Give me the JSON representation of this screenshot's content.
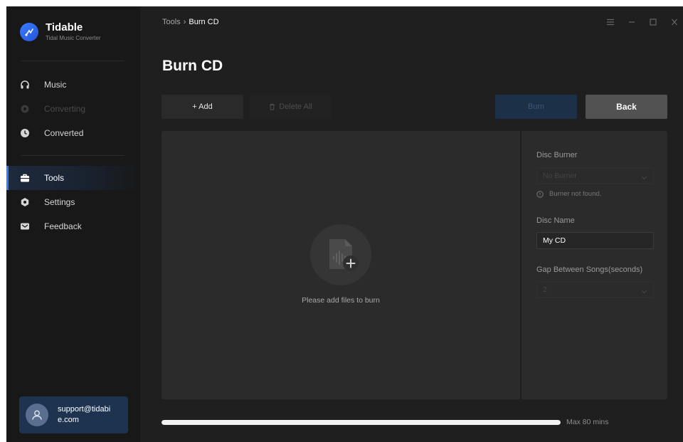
{
  "app": {
    "name": "Tidable",
    "subtitle": "Tidal Music Converter",
    "accent": "#2f7bff"
  },
  "sidebar": {
    "items": [
      {
        "label": "Music",
        "icon": "headphones-icon",
        "state": "normal"
      },
      {
        "label": "Converting",
        "icon": "converting-icon",
        "state": "disabled"
      },
      {
        "label": "Converted",
        "icon": "clock-icon",
        "state": "normal"
      },
      {
        "label": "Tools",
        "icon": "toolbox-icon",
        "state": "active"
      },
      {
        "label": "Settings",
        "icon": "gear-icon",
        "state": "normal"
      },
      {
        "label": "Feedback",
        "icon": "mail-icon",
        "state": "normal"
      }
    ]
  },
  "account": {
    "email": "support@tidabie.com"
  },
  "breadcrumb": {
    "parent": "Tools",
    "separator": "›",
    "current": "Burn CD"
  },
  "page": {
    "title": "Burn CD"
  },
  "toolbar": {
    "add_label": "+ Add",
    "delete_all_label": "Delete All",
    "burn_label": "Burn",
    "back_label": "Back"
  },
  "drop_zone": {
    "message": "Please add files to burn"
  },
  "settings": {
    "disc_burner": {
      "label": "Disc Burner",
      "value": "No Burner",
      "warning": "Burner not found."
    },
    "disc_name": {
      "label": "Disc Name",
      "value": "My CD"
    },
    "gap": {
      "label": "Gap Between Songs(seconds)",
      "value": "2"
    }
  },
  "capacity": {
    "label": "Max 80 mins",
    "fill_fraction": 1.0
  }
}
